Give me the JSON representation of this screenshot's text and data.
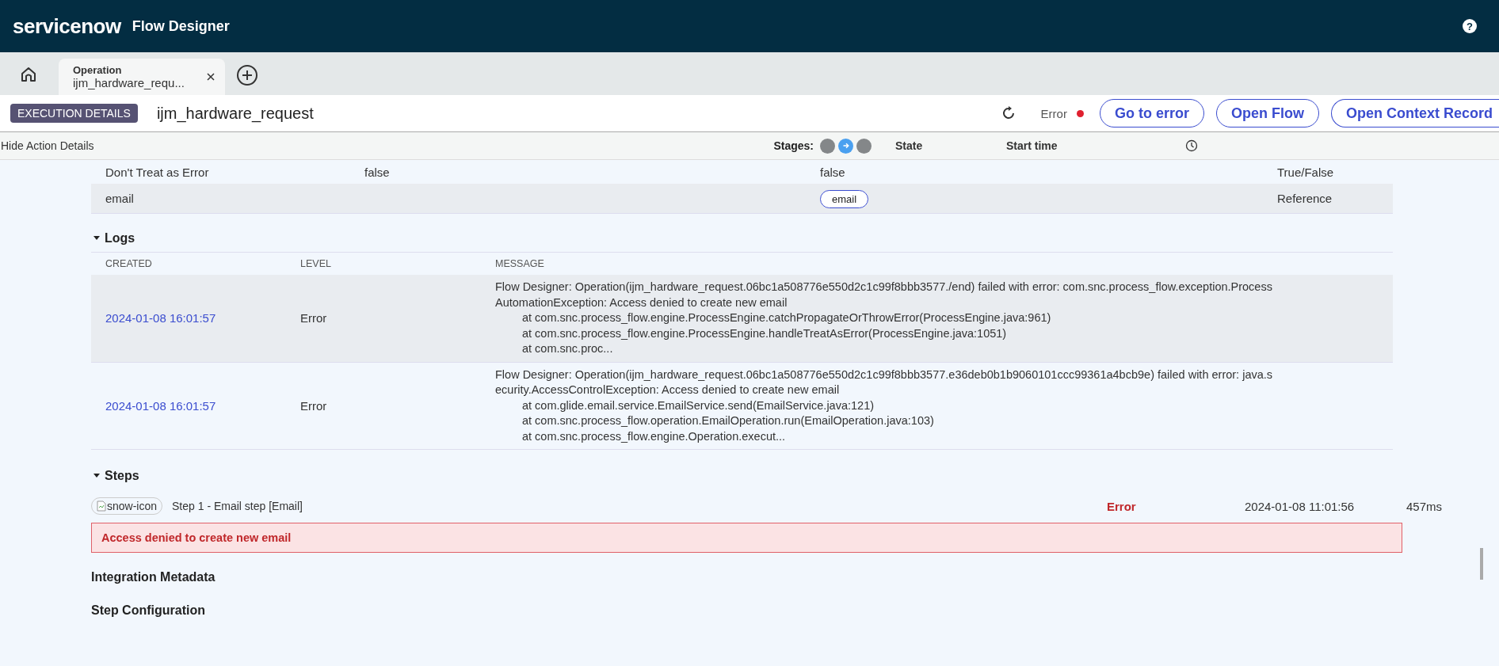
{
  "app": {
    "brand": "servicenow",
    "title": "Flow Designer",
    "help": "?"
  },
  "tabs": [
    {
      "label": "Operation",
      "subtitle": "ijm_hardware_requ...",
      "selected": true
    }
  ],
  "header": {
    "badge": "EXECUTION DETAILS",
    "name": "ijm_hardware_request",
    "status": "Error",
    "buttons": [
      "Go to error",
      "Open Flow",
      "Open Context Record"
    ]
  },
  "subheader": {
    "toggle": "Hide Action Details",
    "stages_label": "Stages:",
    "stages": [
      {
        "selected": false
      },
      {
        "selected": true
      },
      {
        "selected": false
      }
    ],
    "columns": [
      "State",
      "Start time"
    ]
  },
  "inputs": {
    "rows": [
      {
        "name": "Don't Treat as Error",
        "value": "false",
        "kind": "text",
        "display": "false",
        "type": "True/False"
      },
      {
        "name": "email",
        "value": "",
        "kind": "pill",
        "display": "email",
        "type": "Reference"
      }
    ]
  },
  "logs": {
    "title": "Logs",
    "expanded": true,
    "columns": [
      "CREATED",
      "LEVEL",
      "MESSAGE"
    ],
    "rows": [
      {
        "created": "2024-01-08 16:01:57",
        "level": "Error",
        "lines": [
          "Flow Designer: Operation(ijm_hardware_request.06bc1a508776e550d2c1c99f8bbb3577./end) failed with error: com.snc.process_flow.exception.Process",
          "AutomationException: Access denied to create new email"
        ],
        "trace": [
          "at com.snc.process_flow.engine.ProcessEngine.catchPropagateOrThrowError(ProcessEngine.java:961)",
          "at com.snc.process_flow.engine.ProcessEngine.handleTreatAsError(ProcessEngine.java:1051)",
          "at com.snc.proc..."
        ]
      },
      {
        "created": "2024-01-08 16:01:57",
        "level": "Error",
        "lines": [
          "Flow Designer: Operation(ijm_hardware_request.06bc1a508776e550d2c1c99f8bbb3577.e36deb0b1b9060101ccc99361a4bcb9e) failed with error: java.s",
          "ecurity.AccessControlException: Access denied to create new email"
        ],
        "trace": [
          "at com.glide.email.service.EmailService.send(EmailService.java:121)",
          "at com.snc.process_flow.operation.EmailOperation.run(EmailOperation.java:103)",
          "at com.snc.process_flow.engine.Operation.execut..."
        ]
      }
    ]
  },
  "steps": {
    "title": "Steps",
    "expanded": true,
    "items": [
      {
        "icon_alt": "snow-icon",
        "label": "Step 1 - Email step [Email]",
        "state": "Error",
        "start": "2024-01-08 11:01:56",
        "duration": "457ms",
        "error": "Access denied to create new email"
      }
    ]
  },
  "sections": [
    "Integration Metadata",
    "Step Configuration"
  ]
}
